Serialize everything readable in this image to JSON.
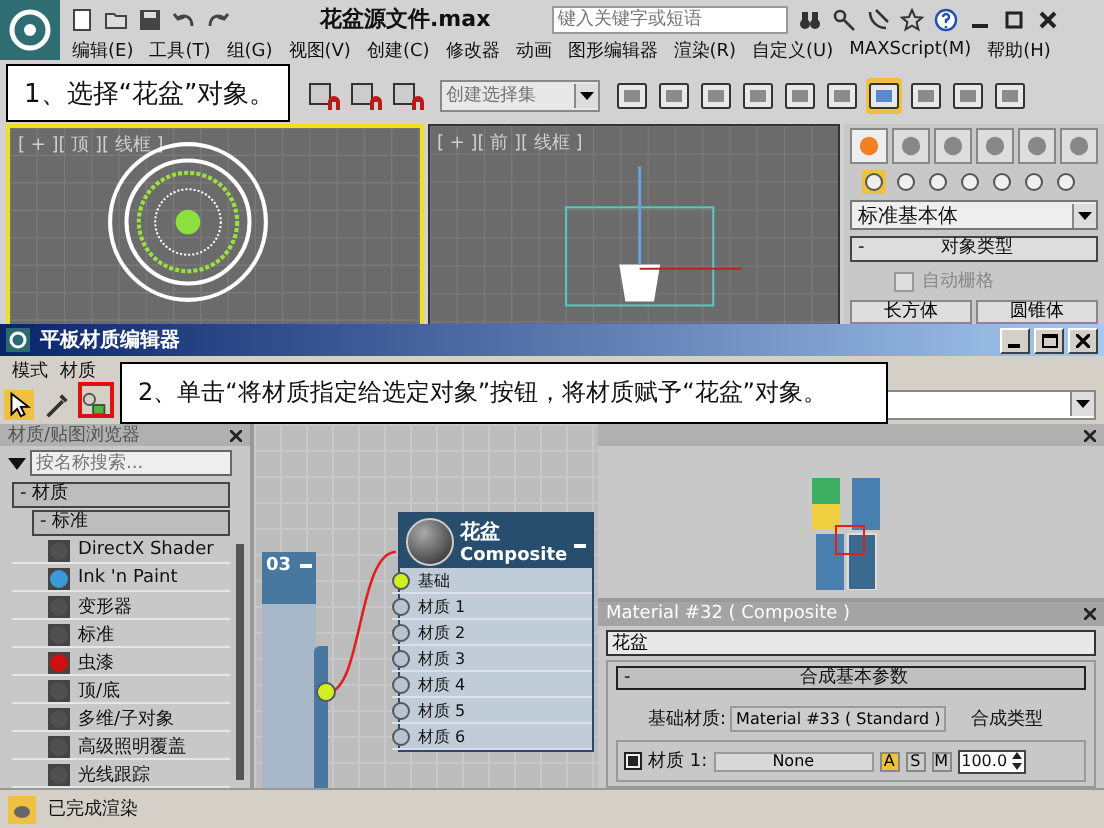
{
  "main_window": {
    "title": "花盆源文件.max",
    "search": {
      "placeholder": "键入关键字或短语"
    },
    "menu": [
      "编辑(E)",
      "工具(T)",
      "组(G)",
      "视图(V)",
      "创建(C)",
      "修改器",
      "动画",
      "图形编辑器",
      "渲染(R)",
      "自定义(U)",
      "MAXScript(M)",
      "帮助(H)"
    ],
    "selection_set": {
      "placeholder": "创建选择集"
    },
    "viewports": [
      {
        "label": "[ + ][ 顶 ][ 线框 ]",
        "active": true
      },
      {
        "label": "[ + ][ 前 ][ 线框 ]",
        "active": false
      }
    ],
    "command_panel": {
      "category": "标准基本体",
      "rollout": {
        "toggle": "-",
        "title": "对象类型"
      },
      "autogrid": {
        "label": "自动栅格",
        "checked": false
      },
      "buttons": [
        "长方体",
        "圆锥体"
      ]
    }
  },
  "material_editor": {
    "title": "平板材质编辑器",
    "menu": [
      "模式",
      "材质"
    ],
    "browser": {
      "title": "材质/贴图浏览器",
      "search": {
        "placeholder": "按名称搜索..."
      },
      "group": "- 材质",
      "subgroup": "- 标准",
      "items": [
        {
          "name": "DirectX Shader",
          "color": "#505050"
        },
        {
          "name": "Ink 'n Paint",
          "color": "#3a9ad8"
        },
        {
          "name": "变形器",
          "color": "#505050"
        },
        {
          "name": "标准",
          "color": "#505050"
        },
        {
          "name": "虫漆",
          "color": "#d01010"
        },
        {
          "name": "顶/底",
          "color": "#505050"
        },
        {
          "name": "多维/子对象",
          "color": "#505050"
        },
        {
          "name": "高级照明覆盖",
          "color": "#505050"
        },
        {
          "name": "光线跟踪",
          "color": "#505050"
        }
      ]
    },
    "partial_node": {
      "title": "03"
    },
    "composite_node": {
      "name": "花盆",
      "type": "Composite",
      "slots": [
        {
          "label": "基础",
          "connected": true
        },
        {
          "label": "材质 1",
          "connected": false
        },
        {
          "label": "材质 2",
          "connected": false
        },
        {
          "label": "材质 3",
          "connected": false
        },
        {
          "label": "材质 4",
          "connected": false
        },
        {
          "label": "材质 5",
          "connected": false
        },
        {
          "label": "材质 6",
          "connected": false
        }
      ]
    },
    "parameters": {
      "title": "Material #32  ( Composite )",
      "name": "花盆",
      "rollout": {
        "toggle": "-",
        "title": "合成基本参数"
      },
      "base_label": "基础材质:",
      "base_button": "Material #33 ( Standard )",
      "composite_type": "合成类型",
      "slots": [
        {
          "label": "材质 1:",
          "enabled": true,
          "material": "None",
          "amount": "100.0",
          "modes": [
            {
              "label": "A",
              "selected": true
            },
            {
              "label": "S",
              "selected": false
            },
            {
              "label": "M",
              "selected": false
            }
          ]
        }
      ]
    },
    "status": "已完成渲染"
  },
  "callouts": [
    "1、选择“花盆”对象。",
    "2、单击“将材质指定给选定对象”按钮，将材质赋予“花盆”对象。"
  ]
}
